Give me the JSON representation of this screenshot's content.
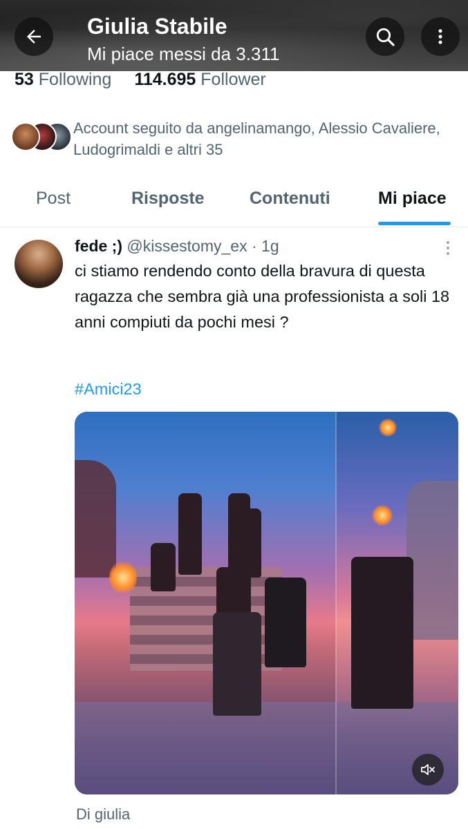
{
  "header": {
    "title": "Giulia Stabile",
    "subtitle": "Mi piace messi da 3.311",
    "background": "#2b2b2b"
  },
  "stats": {
    "following_count": "53",
    "following_label": "Following",
    "followers_count": "114.695",
    "followers_label": "Follower"
  },
  "followed_by": {
    "text": "Account seguito da angelinamango, Alessio Cavaliere, Ludogrimaldi e altri 35"
  },
  "tabs": [
    {
      "label": "Post",
      "active": false
    },
    {
      "label": "Risposte",
      "active": false
    },
    {
      "label": "Contenuti",
      "active": false
    },
    {
      "label": "Mi piace",
      "active": true
    }
  ],
  "tweet": {
    "name": "fede ;)",
    "handle": "@kissestomy_ex",
    "separator": "·",
    "time": "1g",
    "text": "ci stiamo rendendo conto della bravura di questa ragazza che sembra già una professionista a soli 18 anni compiuti da pochi mesi ?",
    "hashtag": "#Amici23"
  },
  "footer": {
    "label": "Di giulia"
  },
  "colors": {
    "accent": "#1d9bf0",
    "secondary_text": "#536471",
    "primary_text": "#0f1419"
  },
  "icons": {
    "back": "arrow-left-icon",
    "search": "search-icon",
    "more": "more-vertical-icon",
    "tweet_more": "more-vertical-icon",
    "mute": "volume-muted-icon"
  }
}
